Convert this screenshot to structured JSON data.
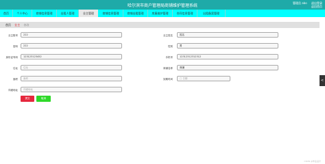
{
  "header": {
    "title": "哈尔滨市商户管理局商铺维护管理系统",
    "user_label": "管理员 abo",
    "exit_label": "退出登录",
    "home_label": "返回首页"
  },
  "nav": {
    "tabs": [
      "首页",
      "个人中心",
      "商铺信息管理",
      "出租人管理",
      "业主管理",
      "商铺信息管理",
      "商铺出租管理",
      "房屋维护管理",
      "合同信息管理",
      "出租备案管理"
    ]
  },
  "breadcrumb": {
    "home": "首页",
    "current": "业主",
    "action": "修改"
  },
  "form": {
    "owner_account_label": "业主账号",
    "owner_account_value": "222",
    "owner_name_label": "业主姓名",
    "owner_name_value": "姓名",
    "password_label": "密码",
    "password_value": "222",
    "gender_label": "性别",
    "gender_value": "男",
    "id_card_label": "身份证号码",
    "id_card_value": "123123123452",
    "phone_label": "手机号",
    "phone_value": "12312312312312",
    "address_label": "住址",
    "address_placeholder": "住址",
    "shop_name_label": "商铺名称",
    "shop_name_value": "商铺",
    "area_label": "面积",
    "area_placeholder": "面积",
    "date_label": "到期时间",
    "date_placeholder": "日期",
    "remark_label": "详细地址",
    "remark_placeholder": "详细地址",
    "submit_label": "提交",
    "cancel_label": "取消"
  },
  "side": {
    "handle_icon": "<"
  },
  "watermark": "CSDN @毕业设计"
}
